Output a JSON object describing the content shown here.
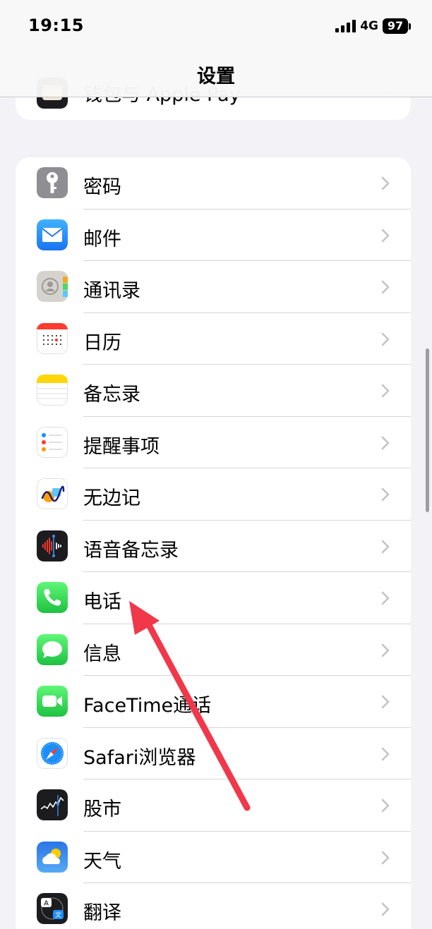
{
  "status_bar": {
    "time": "19:15",
    "network": "4G",
    "battery": "97"
  },
  "nav": {
    "title": "设置"
  },
  "top_group": {
    "item_label": "钱包与 Apple Pay"
  },
  "settings": [
    {
      "label": "密码",
      "icon": "key-icon",
      "color": "#8e8e93"
    },
    {
      "label": "邮件",
      "icon": "mail-icon",
      "color": "#1c8ef9"
    },
    {
      "label": "通讯录",
      "icon": "contacts-icon",
      "color": "#cfcfcf"
    },
    {
      "label": "日历",
      "icon": "calendar-icon",
      "color": "#ffffff"
    },
    {
      "label": "备忘录",
      "icon": "notes-icon",
      "color": "#ffd60a"
    },
    {
      "label": "提醒事项",
      "icon": "reminders-icon",
      "color": "#ffffff"
    },
    {
      "label": "无边记",
      "icon": "freeform-icon",
      "color": "#ffffff"
    },
    {
      "label": "语音备忘录",
      "icon": "voice-memos-icon",
      "color": "#1c1c1e"
    },
    {
      "label": "电话",
      "icon": "phone-icon",
      "color": "#34c759"
    },
    {
      "label": "信息",
      "icon": "messages-icon",
      "color": "#34c759"
    },
    {
      "label": "FaceTime通话",
      "icon": "facetime-icon",
      "color": "#34c759"
    },
    {
      "label": "Safari浏览器",
      "icon": "safari-icon",
      "color": "#1c8ef9"
    },
    {
      "label": "股市",
      "icon": "stocks-icon",
      "color": "#1c1c1e"
    },
    {
      "label": "天气",
      "icon": "weather-icon",
      "color": "#3a8ef5"
    },
    {
      "label": "翻译",
      "icon": "translate-icon",
      "color": "#1c1c1e"
    }
  ]
}
